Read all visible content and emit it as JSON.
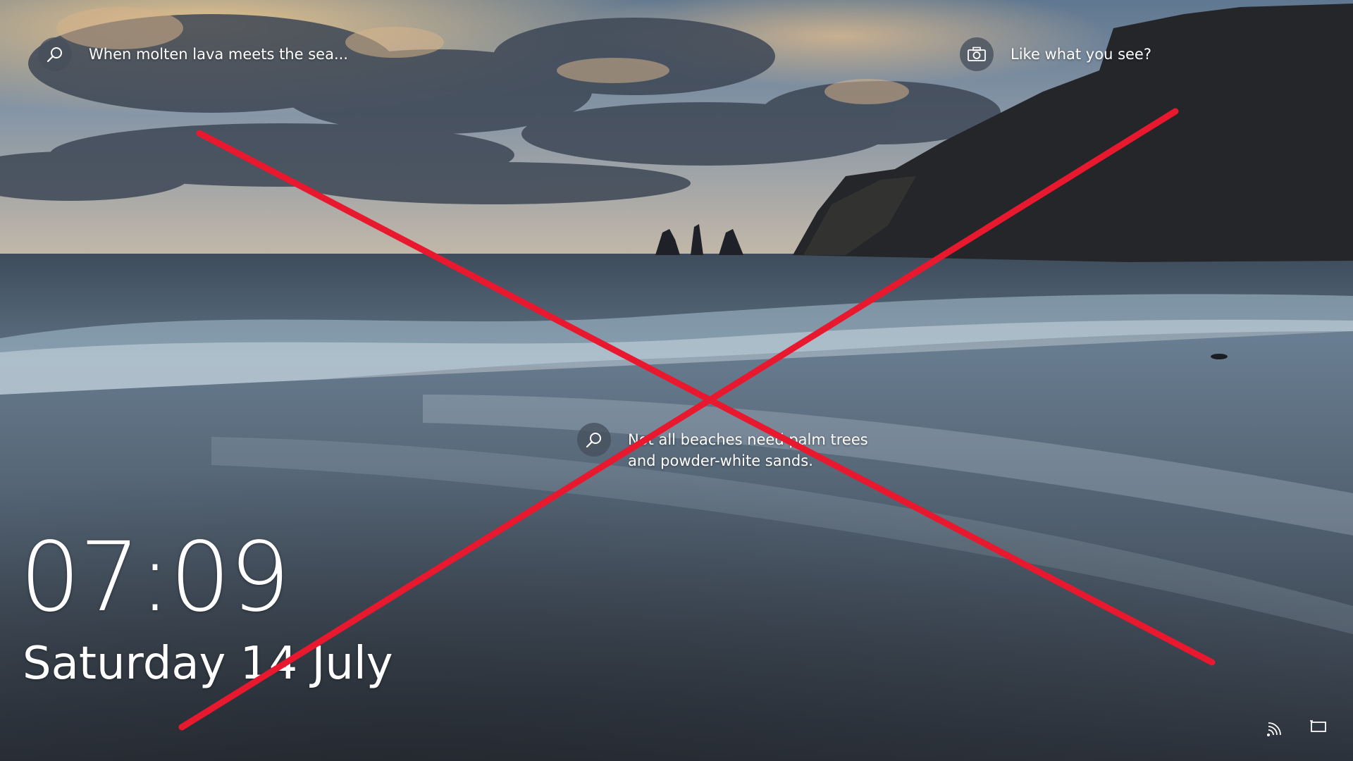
{
  "lock_screen": {
    "spotlight_hint": "When molten lava meets the sea...",
    "feedback_prompt": "Like what you see?",
    "center_hint": "Not all beaches need palm trees and powder-white sands.",
    "time": "07:09",
    "date": "Saturday 14 July"
  },
  "icons": {
    "hint_top": "search-icon",
    "feedback": "camera-icon",
    "hint_center": "search-icon",
    "network": "wifi-icon",
    "battery": "battery-icon"
  },
  "colors": {
    "overlay_x": "#e8182f",
    "hotspot_bg": "#46505c"
  }
}
